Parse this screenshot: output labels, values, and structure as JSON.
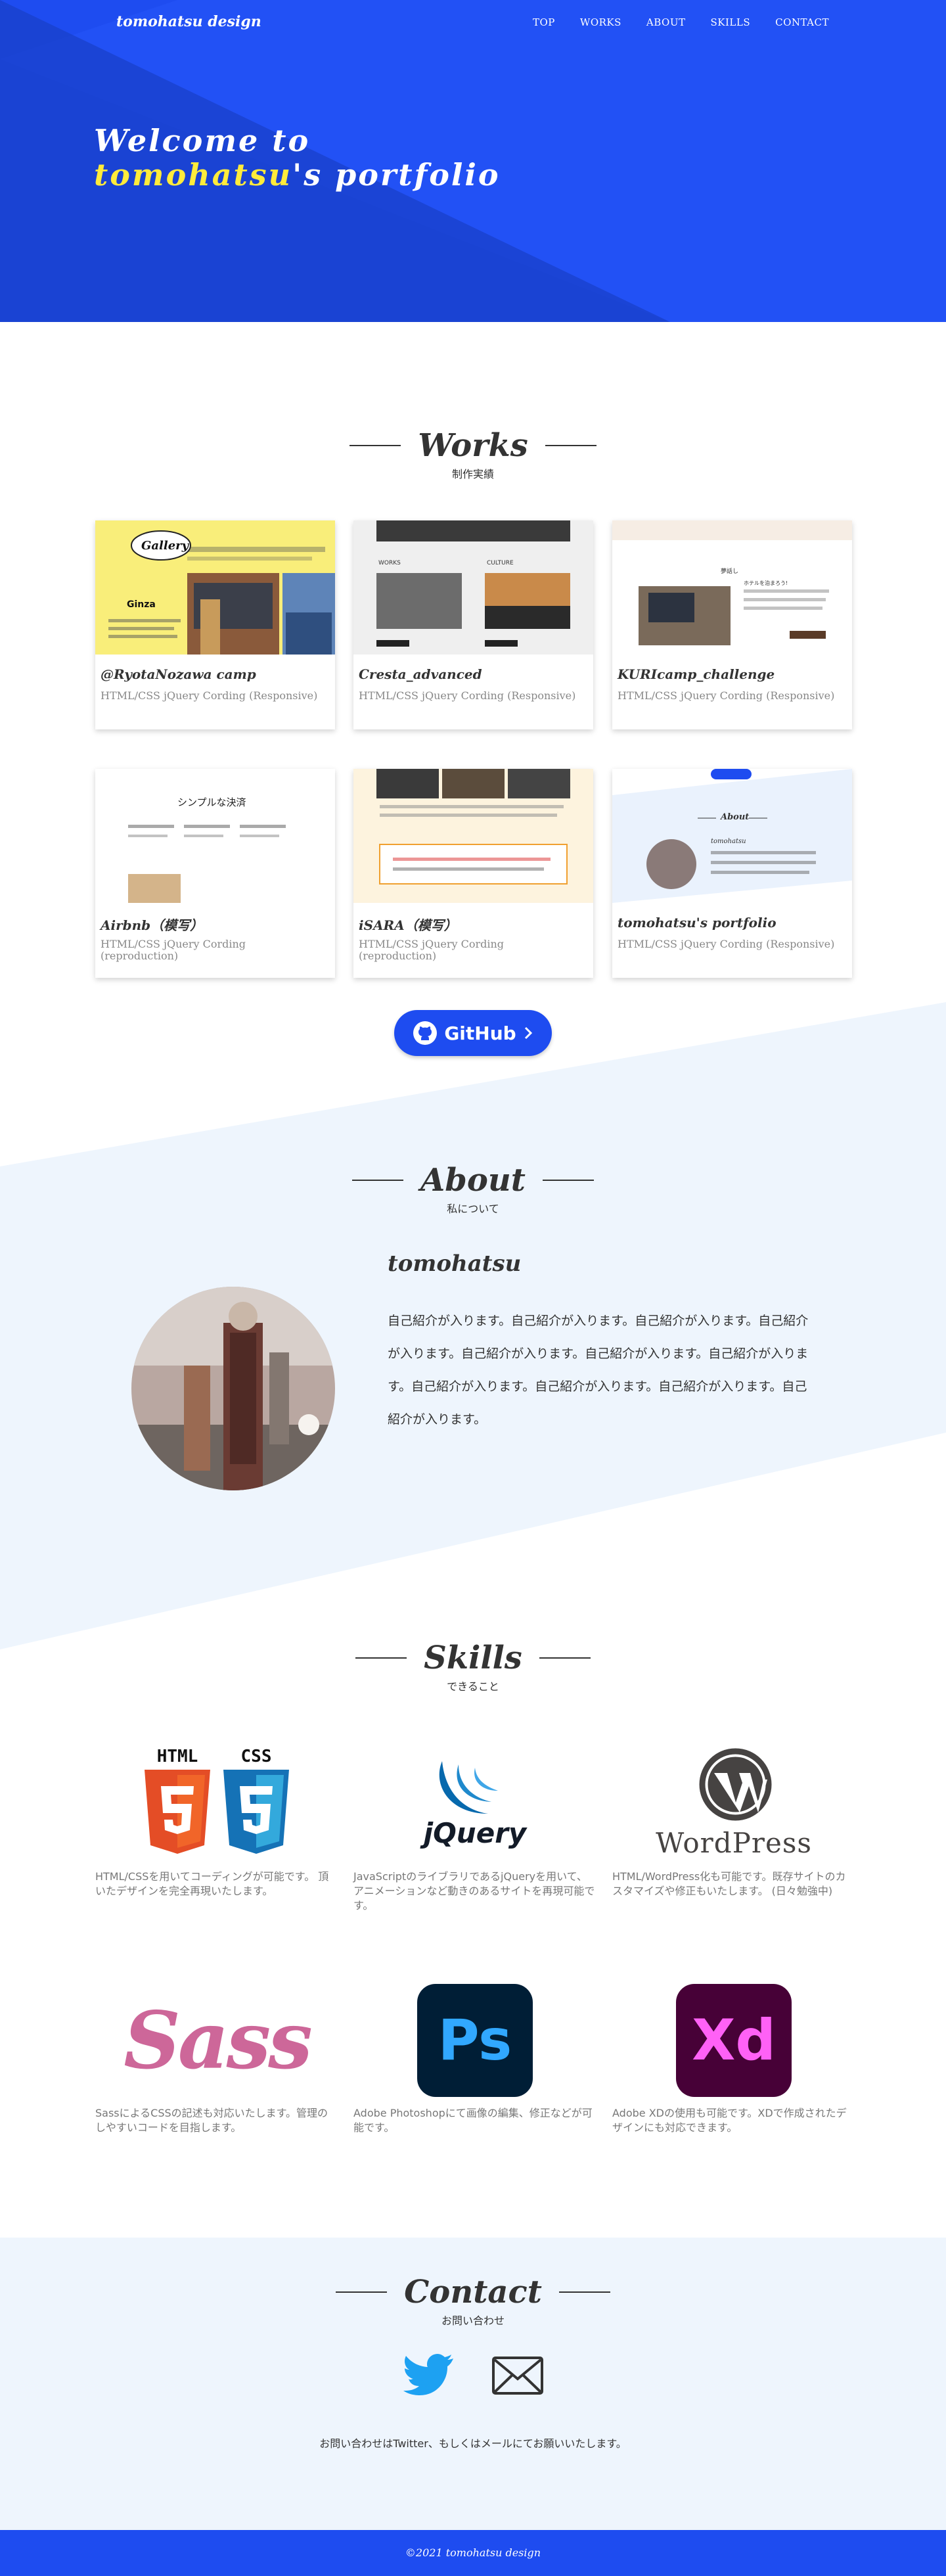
{
  "nav": {
    "logo": "tomohatsu design",
    "links": [
      "TOP",
      "WORKS",
      "ABOUT",
      "SKILLS",
      "CONTACT"
    ]
  },
  "hero": {
    "line1": "Welcome to",
    "highlight": "tomohatsu",
    "line2_rest": "'s portfolio"
  },
  "works": {
    "title": "Works",
    "subtitle": "制作実績",
    "cards": [
      {
        "title": "@RyotaNozawa camp",
        "desc": "HTML/CSS jQuery Cording (Responsive)",
        "thumb_labels": [
          "Gallery",
          "Ginza"
        ]
      },
      {
        "title": "Cresta_advanced",
        "desc": "HTML/CSS jQuery Cording (Responsive)",
        "thumb_labels": [
          "WORKS",
          "CULTURE"
        ]
      },
      {
        "title": "KURIcamp_challenge",
        "desc": "HTML/CSS jQuery Cording (Responsive)",
        "thumb_labels": [
          "夢話し",
          "ホテルを泊まろう!"
        ]
      },
      {
        "title": "Airbnb（模写）",
        "desc": "HTML/CSS jQuery Cording (reproduction)",
        "thumb_labels": [
          "シンプルな決済"
        ]
      },
      {
        "title": "iSARA（模写）",
        "desc": "HTML/CSS jQuery Cording (reproduction)",
        "thumb_labels": []
      },
      {
        "title": "tomohatsu's portfolio",
        "desc": "HTML/CSS jQuery Cording (Responsive)",
        "thumb_labels": [
          "About",
          "tomohatsu"
        ]
      }
    ],
    "github_label": "GitHub"
  },
  "about": {
    "title": "About",
    "subtitle": "私について",
    "name": "tomohatsu",
    "text": "自己紹介が入ります。自己紹介が入ります。自己紹介が入ります。自己紹介が入ります。自己紹介が入ります。自己紹介が入ります。自己紹介が入ります。自己紹介が入ります。自己紹介が入ります。自己紹介が入ります。自己紹介が入ります。"
  },
  "skills": {
    "title": "Skills",
    "subtitle": "できること",
    "items": [
      {
        "name": "html-css",
        "logo_texts": [
          "HTML",
          "CSS"
        ],
        "text": "HTML/CSSを用いてコーディングが可能です。 頂いたデザインを完全再現いたします。"
      },
      {
        "name": "jquery",
        "logo_texts": [
          "jQuery"
        ],
        "text": "JavaScriptのライブラリであるjQueryを用いて、アニメーションなど動きのあるサイトを再現可能です。"
      },
      {
        "name": "wordpress",
        "logo_texts": [
          "WordPress"
        ],
        "text": "HTML/WordPress化も可能です。既存サイトのカスタマイズや修正もいたします。 (日々勉強中)"
      },
      {
        "name": "sass",
        "logo_texts": [
          "Sass"
        ],
        "text": "SassによるCSSの記述も対応いたします。管理のしやすいコードを目指します。"
      },
      {
        "name": "photoshop",
        "logo_texts": [
          "Ps"
        ],
        "text": "Adobe Photoshopにて画像の編集、修正などが可能です。"
      },
      {
        "name": "xd",
        "logo_texts": [
          "Xd"
        ],
        "text": "Adobe XDの使用も可能です。XDで作成されたデザインにも対応できます。"
      }
    ]
  },
  "contact": {
    "title": "Contact",
    "subtitle": "お問い合わせ",
    "text": "お問い合わせはTwitter、もしくはメールにてお願いいたします。"
  },
  "footer": {
    "copyright": "©2021 tomohatsu design"
  },
  "colors": {
    "brand": "#1e4cf0",
    "highlight": "#ffeb3b",
    "about_bg": "#eef5fd"
  }
}
